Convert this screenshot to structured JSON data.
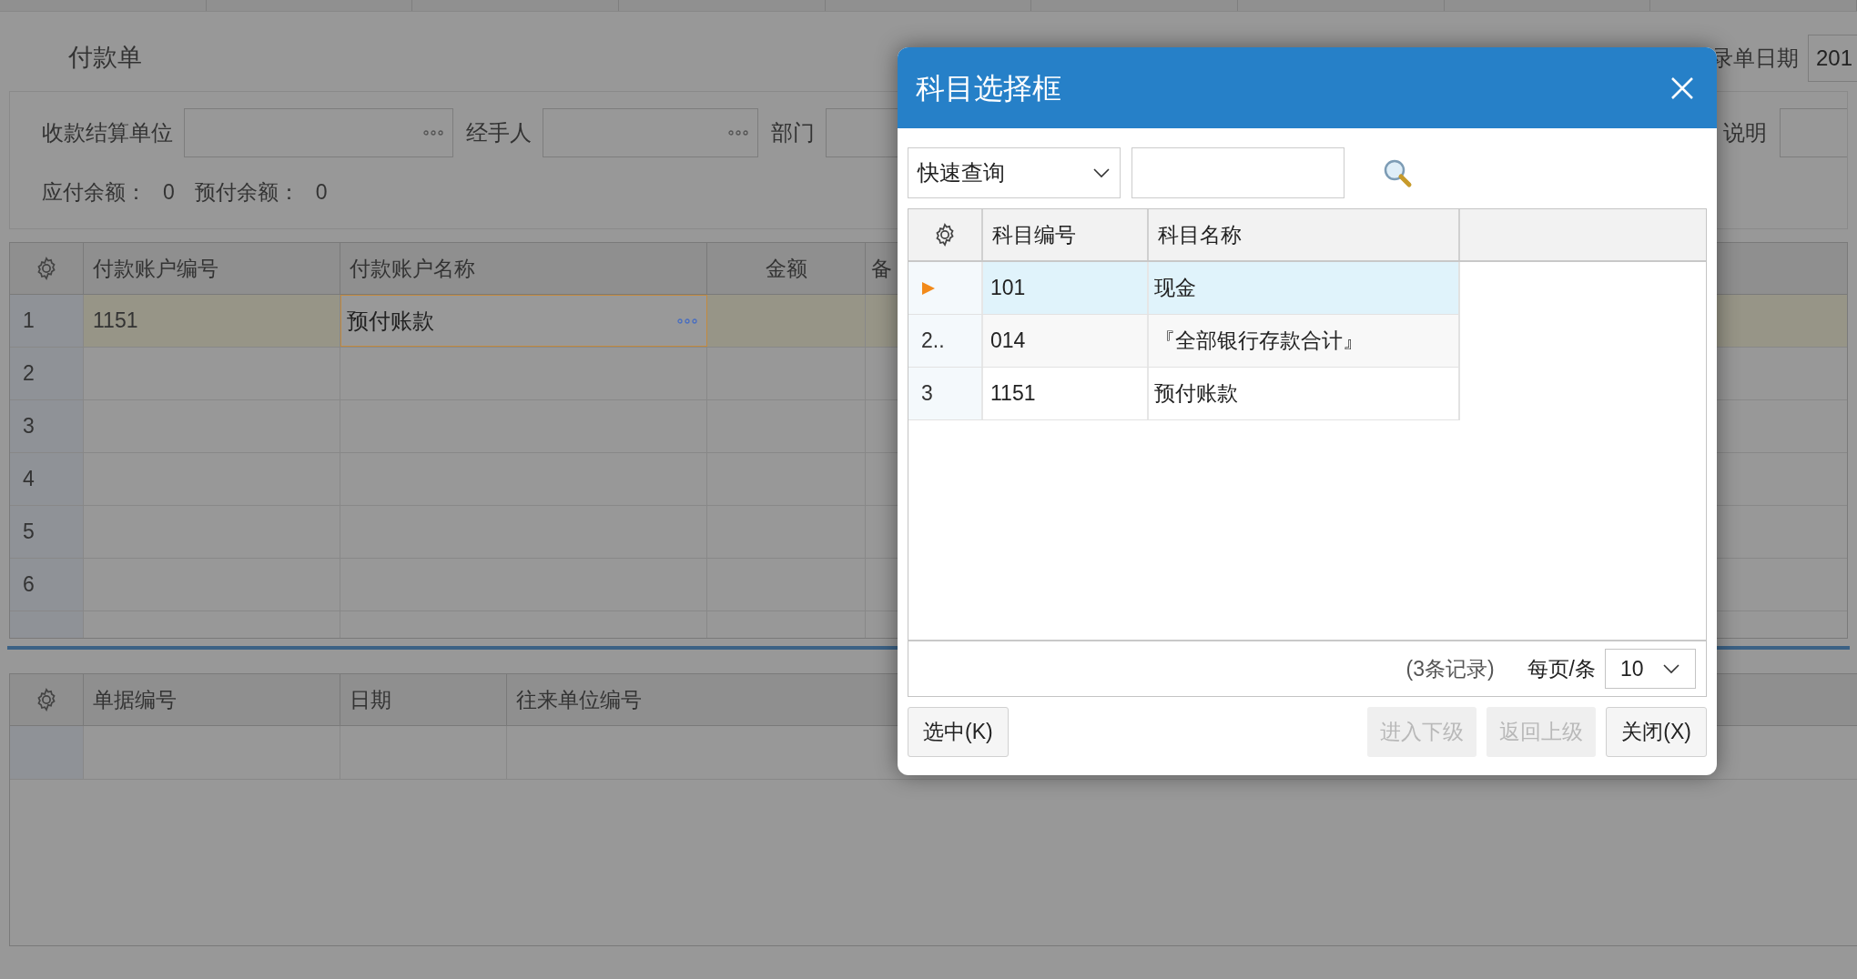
{
  "page": {
    "title": "付款单"
  },
  "form": {
    "fields": [
      {
        "label": "收款结算单位",
        "kind": "lookup"
      },
      {
        "label": "经手人",
        "kind": "lookup"
      },
      {
        "label": "部门",
        "kind": "text"
      }
    ],
    "right_fields": [
      {
        "label": "录单日期",
        "value": "201"
      },
      {
        "label": "说明"
      }
    ],
    "balances": [
      {
        "label": "应付余额：",
        "value": "0"
      },
      {
        "label": "预付余额：",
        "value": "0"
      }
    ]
  },
  "grid": {
    "columns": [
      "付款账户编号",
      "付款账户名称",
      "金额",
      "备"
    ],
    "rows": [
      {
        "number": "1",
        "account_code": "1151",
        "account_name": "预付账款",
        "selected": true
      },
      {
        "number": "2",
        "selected": false
      },
      {
        "number": "3",
        "selected": false
      },
      {
        "number": "4",
        "selected": false
      },
      {
        "number": "5",
        "selected": false
      },
      {
        "number": "6",
        "selected": false
      }
    ]
  },
  "bottom_grid": {
    "columns": [
      "单据编号",
      "日期",
      "往来单位编号"
    ]
  },
  "dialog": {
    "title": "科目选择框",
    "search": {
      "mode": "快速查询"
    },
    "columns": [
      "科目编号",
      "科目名称"
    ],
    "rows": [
      {
        "code": "101",
        "name": "现金",
        "selected": true
      },
      {
        "number": "2..",
        "code": "014",
        "name": "『全部银行存款合计』",
        "selected": false
      },
      {
        "number": "3",
        "code": "1151",
        "name": "预付账款",
        "selected": false
      }
    ],
    "record_count": "(3条记录)",
    "page_size_label": "每页/条",
    "page_size": "10",
    "left_buttons": [
      {
        "label": "选中(K)",
        "disabled": false
      }
    ],
    "right_buttons": [
      {
        "label": "进入下级",
        "disabled": true
      },
      {
        "label": "返回上级",
        "disabled": true
      },
      {
        "label": "关闭(X)",
        "disabled": false
      }
    ]
  }
}
